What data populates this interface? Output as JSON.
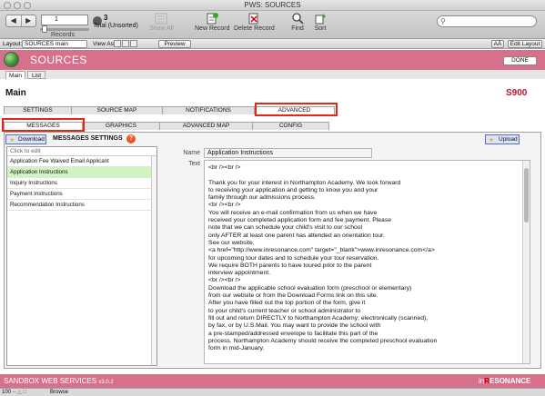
{
  "window": {
    "title": "PWS: SOURCES"
  },
  "toolbar": {
    "record_number": "1",
    "total_count": "3",
    "total_label": "Total (Unsorted)",
    "records_label": "Records",
    "show_all": "Show All",
    "new_record": "New Record",
    "delete_record": "Delete Record",
    "find": "Find",
    "sort": "Sort",
    "search_placeholder": ""
  },
  "layoutbar": {
    "layout_label": "Layout:",
    "layout_value": "SOURCES main",
    "view_as_label": "View As:",
    "preview": "Preview",
    "font_size": "AÂ",
    "edit_layout": "Edit Layout"
  },
  "header": {
    "title": "SOURCES",
    "done": "DONE"
  },
  "mltabs": [
    "Main",
    "List"
  ],
  "main": {
    "title": "Main",
    "price": "S900"
  },
  "tabs_top": [
    "SETTINGS",
    "SOURCE MAP",
    "NOTIFICATIONS",
    "ADVANCED"
  ],
  "tabs_sub": [
    "MESSAGES",
    "GRAPHICS",
    "ADVANCED MAP",
    "CONFIG"
  ],
  "messages": {
    "download": "Download",
    "settings_label": "MESSAGES SETTINGS",
    "help": "?",
    "upload": "Upload",
    "list_header": "Click to edit",
    "items": [
      "Application Fee Waived Email Applicant",
      "Application Instructions",
      "Inquiry Instructions",
      "Payment Instructions",
      "Recommendation Instructions"
    ],
    "name_label": "Name",
    "text_label": "Text",
    "name_value": "Application Instructions",
    "text_lines": [
      "<br /><br />",
      "",
      "Thank you for your interest in Northampton Academy. We look forward",
      "to receiving your application and getting to know you and your",
      "family through our admissions process.",
      "<br /><br />",
      "You will receive an e-mail confirmation from us when we have",
      "received your completed application form and fee payment. Please",
      "note that we can schedule your child's visit to our school",
      "only AFTER at least one parent has attended an orientation tour.",
      "See our website,",
      "<a href=\"http://www.inresonance.com\" target=\"_blank\">www.inresonance.com</a>",
      "for upcoming tour dates and to schedule your tour reservation.",
      "We require BOTH parents to have toured prior to the parent",
      "interview appointment.",
      "<br /><br />",
      "Download the applicable school evaluation form (preschool or elementary)",
      "from our website or from the Download Forms link on this site.",
      "After you have filled out the top portion of the form, give it",
      "to your child's current teacher or school administrator to",
      "fill out and return DIRECTLY to Northampton Academy; electronically (scanned),",
      "by fax, or by U.S.Mail. You may want to provide the school with",
      "a pre-stamped/addressed envelope to facilitate this part of the",
      "process. Northampton Academy should receive the completed preschool evaluation",
      "form in mid-January."
    ]
  },
  "footer": {
    "left": "SANDBOX WEB SERVICES",
    "version": "v3.0.2",
    "right_in": "in",
    "right_accent": "R",
    "right_rest": "ESONANCE"
  },
  "statusbar": {
    "zoom": "100",
    "mode": "Browse"
  }
}
